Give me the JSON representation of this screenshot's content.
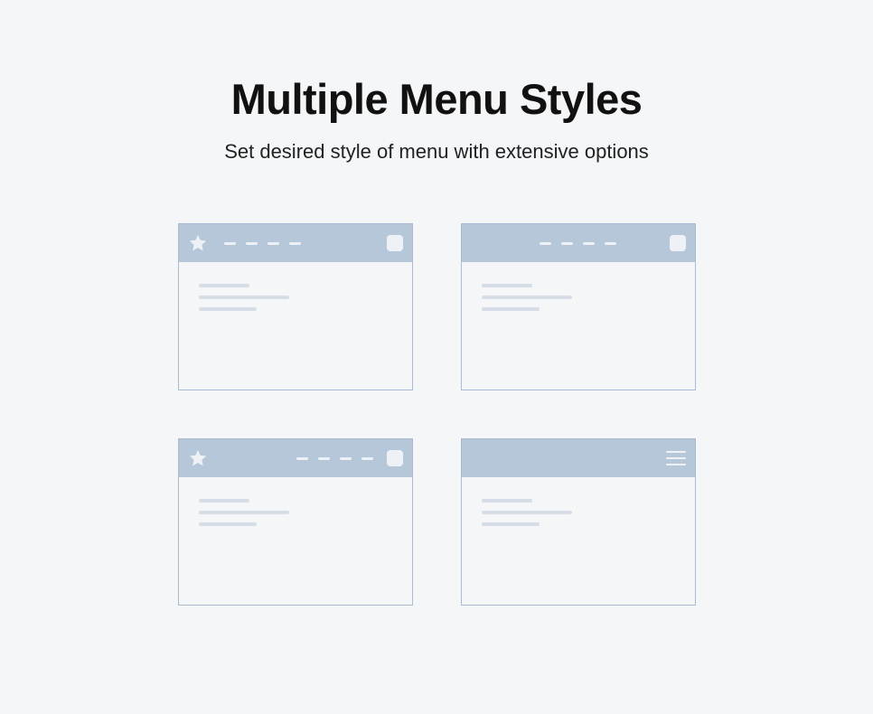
{
  "heading": {
    "title": "Multiple Menu Styles",
    "subtitle": "Set desired style of menu with extensive options"
  },
  "cards": [
    {
      "id": "menu-style-left-star-dashes",
      "header": "star-left-dashes-square"
    },
    {
      "id": "menu-style-center-dashes",
      "header": "center-dashes-square"
    },
    {
      "id": "menu-style-star-right-dashes",
      "header": "star-right-dashes-square"
    },
    {
      "id": "menu-style-hamburger",
      "header": "hamburger-right"
    }
  ]
}
